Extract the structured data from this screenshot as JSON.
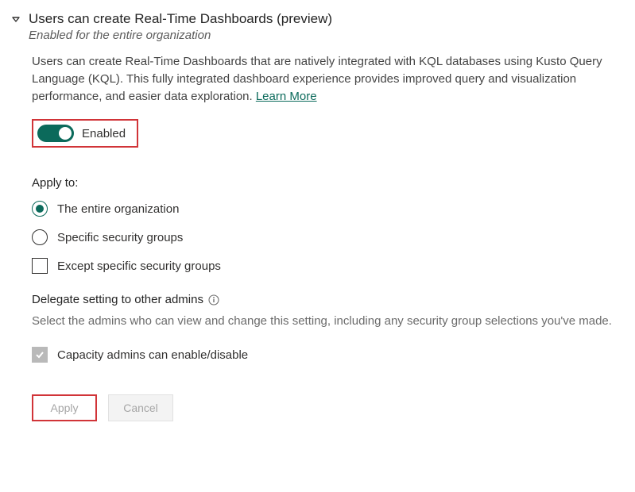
{
  "header": {
    "title": "Users can create Real-Time Dashboards (preview)",
    "subtitle": "Enabled for the entire organization"
  },
  "description": "Users can create Real-Time Dashboards that are natively integrated with KQL databases using Kusto Query Language (KQL). This fully integrated dashboard experience provides improved query and visualization performance, and easier data exploration.  ",
  "learn_more": "Learn More",
  "toggle": {
    "label": "Enabled",
    "state": true
  },
  "apply_to": {
    "label": "Apply to:",
    "options": {
      "org": "The entire organization",
      "groups": "Specific security groups"
    },
    "except": "Except specific security groups"
  },
  "delegate": {
    "title": "Delegate setting to other admins",
    "description": "Select the admins who can view and change this setting, including any security group selections you've made.",
    "checkbox_label": "Capacity admins can enable/disable"
  },
  "buttons": {
    "apply": "Apply",
    "cancel": "Cancel"
  }
}
